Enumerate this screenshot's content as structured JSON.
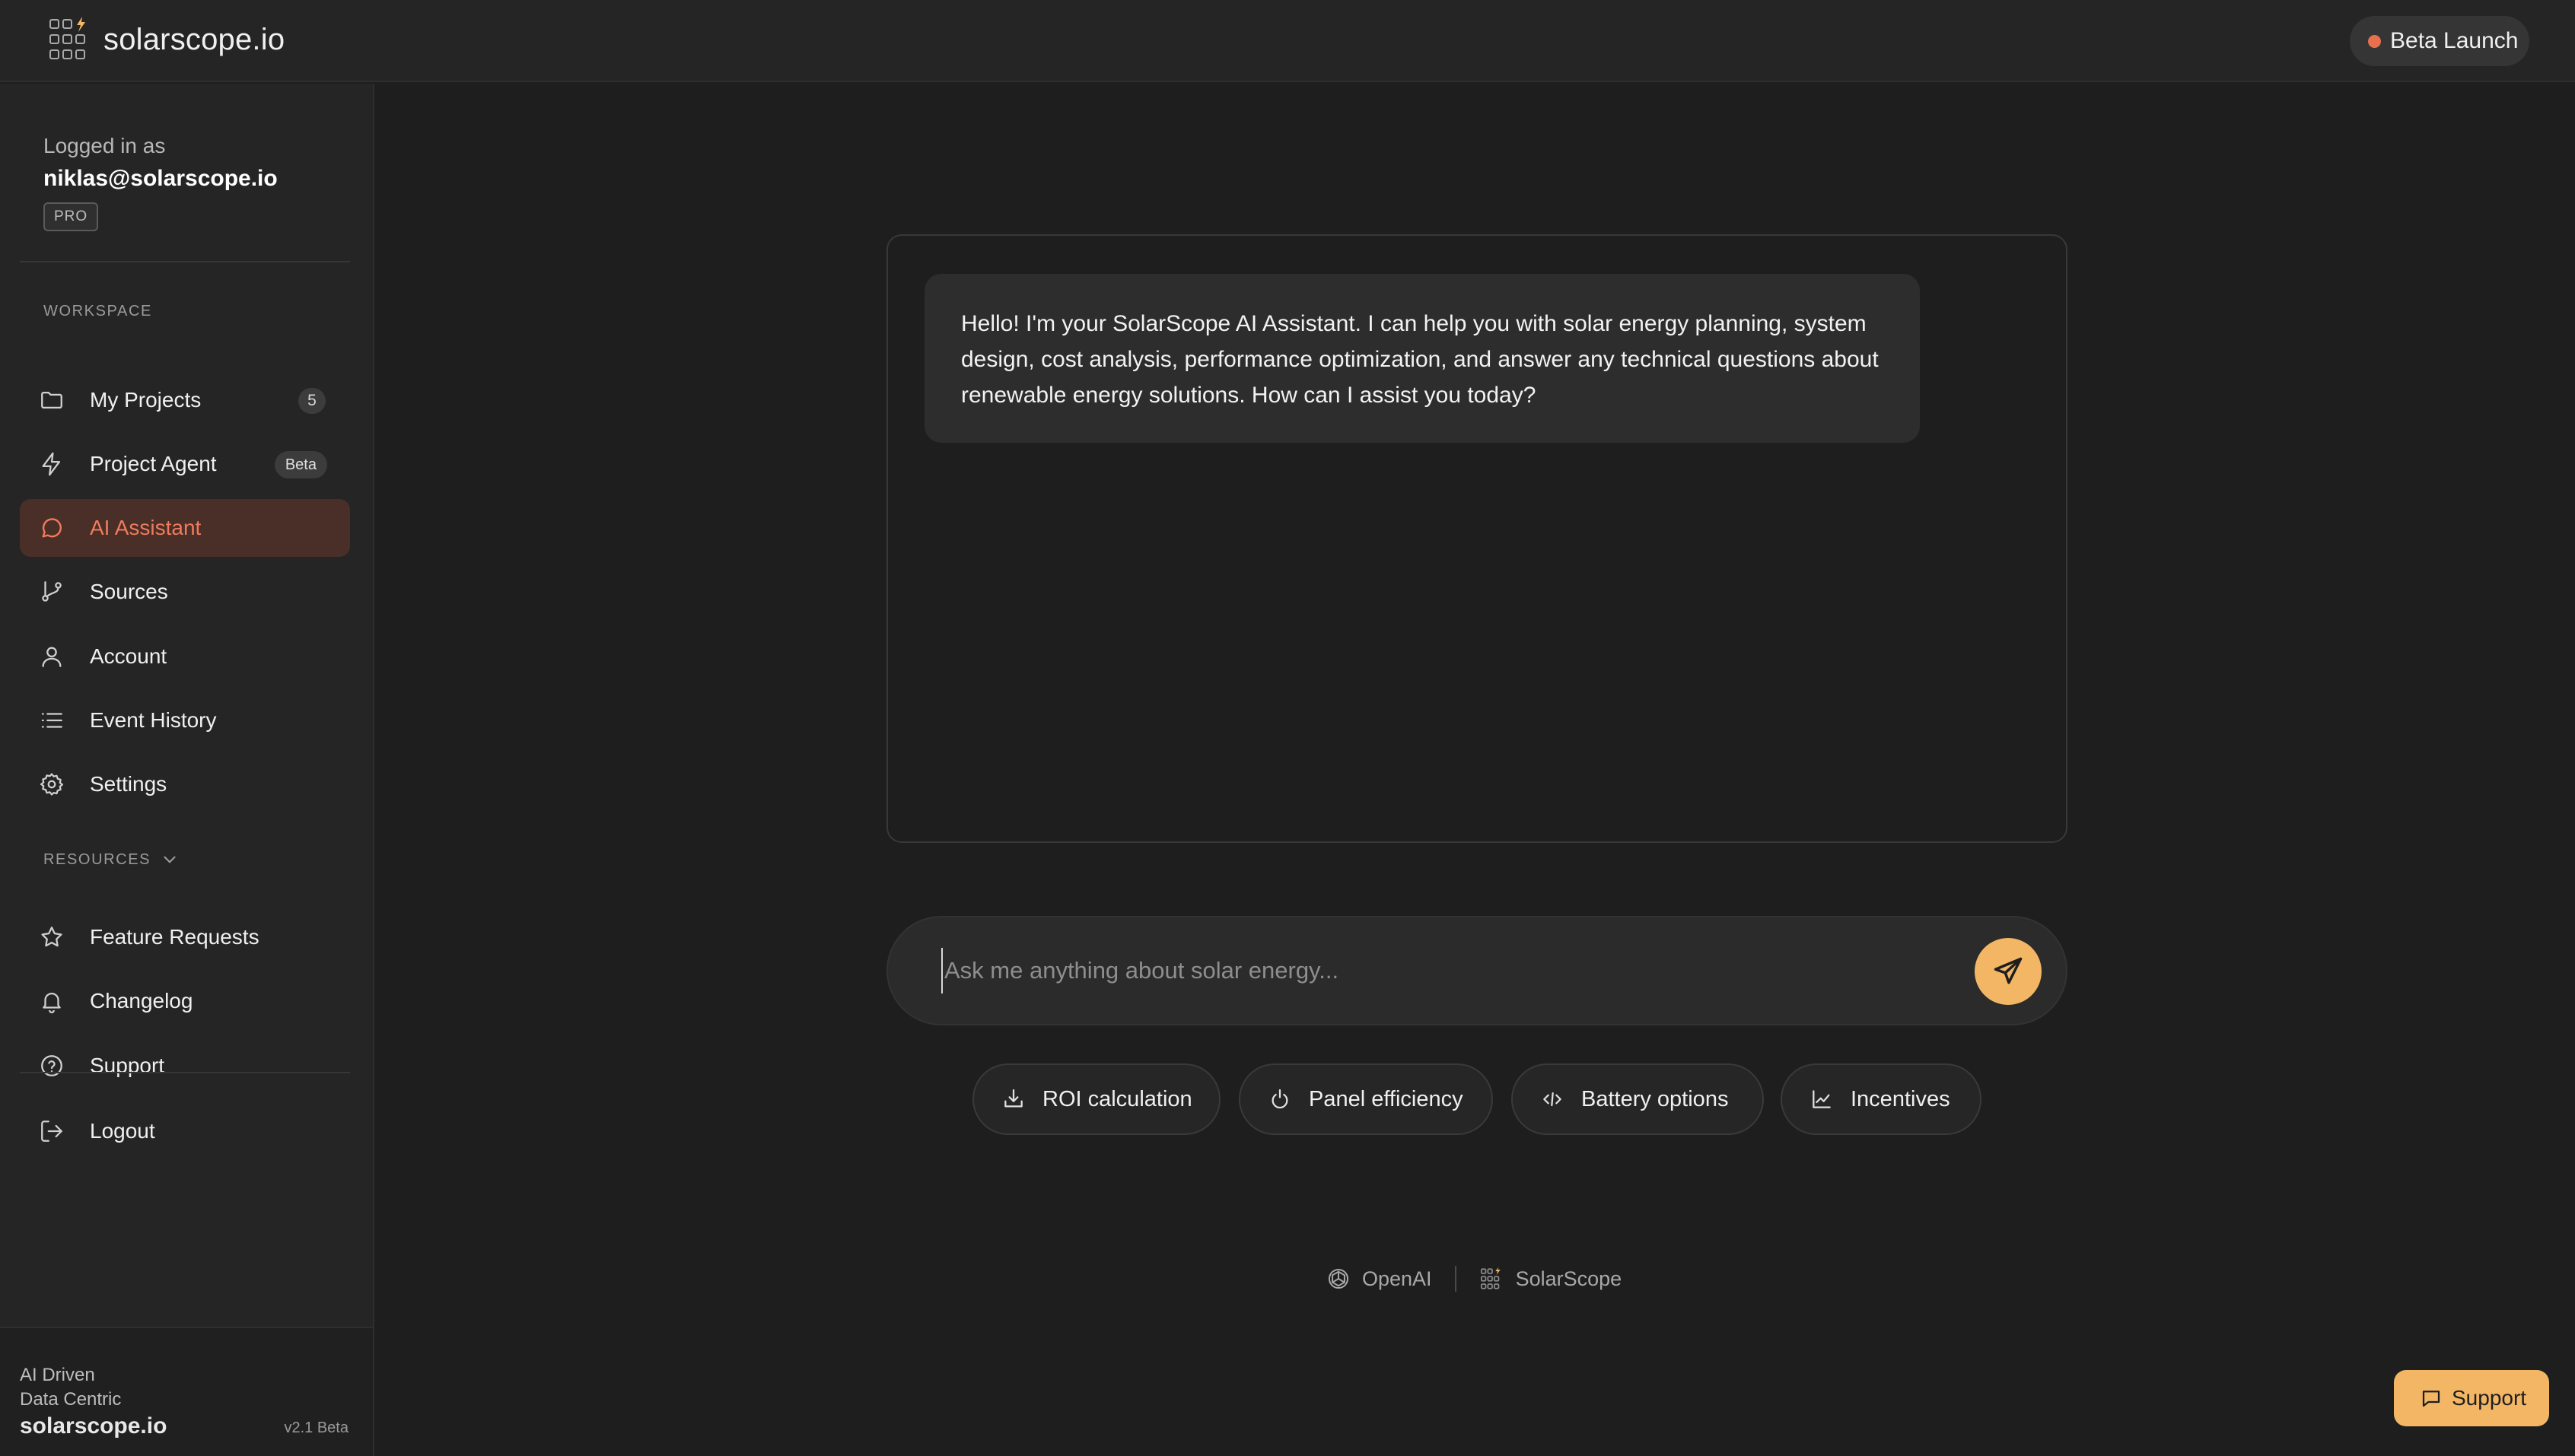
{
  "header": {
    "brand": "solarscope.io",
    "status_pill": "Beta Launch",
    "status_color": "#e8704d"
  },
  "sidebar": {
    "logged_in_label": "Logged in as",
    "user_email": "niklas@solarscope.io",
    "plan_badge": "PRO",
    "workspace_label": "WORKSPACE",
    "workspace_items": [
      {
        "label": "My Projects",
        "icon": "folder-icon",
        "badge": "5"
      },
      {
        "label": "Project Agent",
        "icon": "lightning-icon",
        "badge": "Beta"
      },
      {
        "label": "AI Assistant",
        "icon": "chat-bubble-icon",
        "active": true
      },
      {
        "label": "Sources",
        "icon": "git-branch-icon"
      },
      {
        "label": "Account",
        "icon": "user-icon"
      },
      {
        "label": "Event History",
        "icon": "list-icon"
      },
      {
        "label": "Settings",
        "icon": "gear-icon"
      }
    ],
    "resources_label": "RESOURCES",
    "resources_items": [
      {
        "label": "Feature Requests",
        "icon": "star-icon"
      },
      {
        "label": "Changelog",
        "icon": "bell-icon"
      },
      {
        "label": "Support",
        "icon": "help-circle-icon"
      }
    ],
    "logout_label": "Logout",
    "footer": {
      "line1": "AI Driven",
      "line2": "Data Centric",
      "brand": "solarscope.io",
      "version": "v2.1 Beta"
    }
  },
  "chat": {
    "assistant_message": "Hello! I'm your SolarScope AI Assistant. I can help you with solar energy planning, system design, cost analysis, performance optimization, and answer any technical questions about renewable energy solutions. How can I assist you today?",
    "input_placeholder": "Ask me anything about solar energy...",
    "input_value": "",
    "suggestions": [
      {
        "label": "ROI calculation",
        "icon": "download-tray-icon"
      },
      {
        "label": "Panel efficiency",
        "icon": "power-icon"
      },
      {
        "label": "Battery options",
        "icon": "code-arrows-icon"
      },
      {
        "label": "Incentives",
        "icon": "line-chart-icon"
      }
    ],
    "powered_by": [
      "OpenAI",
      "SolarScope"
    ]
  },
  "support_button": "Support",
  "colors": {
    "accent": "#f3b665",
    "active_text": "#ee7b5c",
    "active_bg": "#4a2e28",
    "background": "#1e1e1e",
    "panel": "#252525"
  }
}
